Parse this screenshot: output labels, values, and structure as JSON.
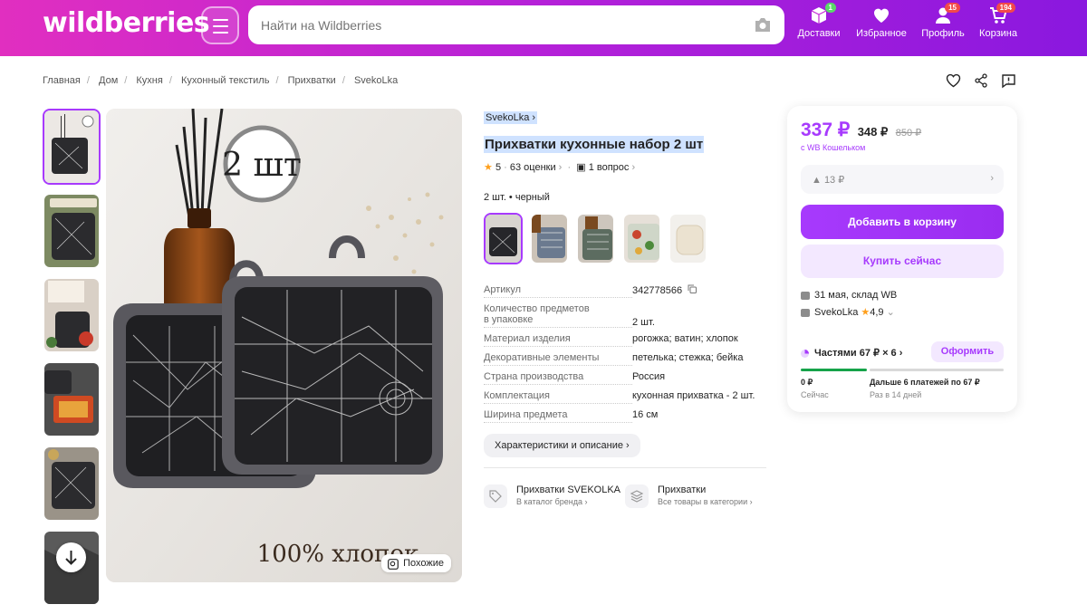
{
  "header": {
    "logo": "wildberries",
    "search_placeholder": "Найти на Wildberries",
    "nav": [
      {
        "label": "Доставки",
        "icon": "box-icon",
        "badge": "1"
      },
      {
        "label": "Избранное",
        "icon": "heart-icon",
        "badge": ""
      },
      {
        "label": "Профиль",
        "icon": "user-icon",
        "badge": "15"
      },
      {
        "label": "Корзина",
        "icon": "cart-icon",
        "badge": "194"
      }
    ]
  },
  "breadcrumbs": [
    "Главная",
    "Дом",
    "Кухня",
    "Кухонный текстиль",
    "Прихватки",
    "SvekoLka"
  ],
  "gallery": {
    "similar_label": "Похожие",
    "main_text_count": "2 шт",
    "main_text_material": "100% хлопок"
  },
  "product": {
    "brand": "SvekoLka",
    "title": "Прихватки кухонные набор 2 шт",
    "rating": "5",
    "reviews": "63 оценки",
    "questions": "1 вопрос",
    "variant": "2 шт. • черный",
    "specs": [
      {
        "k": "Артикул",
        "v": "342778566"
      },
      {
        "k": "Количество предметов в упаковке",
        "v": "2 шт."
      },
      {
        "k": "Материал изделия",
        "v": "рогожка; ватин; хлопок"
      },
      {
        "k": "Декоративные элементы",
        "v": "петелька; стежка; бейка"
      },
      {
        "k": "Страна производства",
        "v": "Россия"
      },
      {
        "k": "Комплектация",
        "v": "кухонная прихватка - 2 шт."
      },
      {
        "k": "Ширина предмета",
        "v": "16 см"
      }
    ],
    "char_button": "Характеристики и описание",
    "links": [
      {
        "title": "Прихватки SVEKOLKA",
        "sub": "В каталог бренда"
      },
      {
        "title": "Прихватки",
        "sub": "Все товары в категории"
      }
    ]
  },
  "buy": {
    "price": "337 ₽",
    "price_old_wallet": "348 ₽",
    "price_old": "850 ₽",
    "wallet_note": "с WB Кошельком",
    "delta": "▲ 13 ₽",
    "add_to_cart": "Добавить в корзину",
    "buy_now": "Купить сейчас",
    "delivery": "31 мая, склад WB",
    "seller": "SvekoLka",
    "seller_rating": "4,9",
    "installments": "Частями 67 ₽ × 6",
    "installments_button": "Оформить",
    "pay_now": "0 ₽",
    "pay_now_label": "Сейчас",
    "pay_later": "Дальше 6 платежей по 67 ₽",
    "pay_later_label": "Раз в 14 дней"
  },
  "colors": {
    "accent": "#a73afd",
    "header_start": "#e12fc0",
    "header_end": "#8a18df"
  }
}
